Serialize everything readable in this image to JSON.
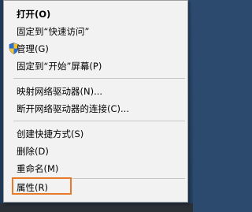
{
  "context_menu": {
    "items": [
      {
        "label": "打开(O)",
        "bold": true
      },
      {
        "label": "固定到“快速访问”"
      },
      {
        "label": "管理(G)",
        "icon": "uac-shield-icon"
      },
      {
        "label": "固定到“开始”屏幕(P)"
      },
      {
        "label": "映射网络驱动器(N)..."
      },
      {
        "label": "断开网络驱动器的连接(C)..."
      },
      {
        "label": "创建快捷方式(S)"
      },
      {
        "label": "删除(D)"
      },
      {
        "label": "重命名(M)"
      },
      {
        "label": "属性(R)",
        "highlighted": true
      }
    ],
    "highlight_color": "#e8792a"
  }
}
